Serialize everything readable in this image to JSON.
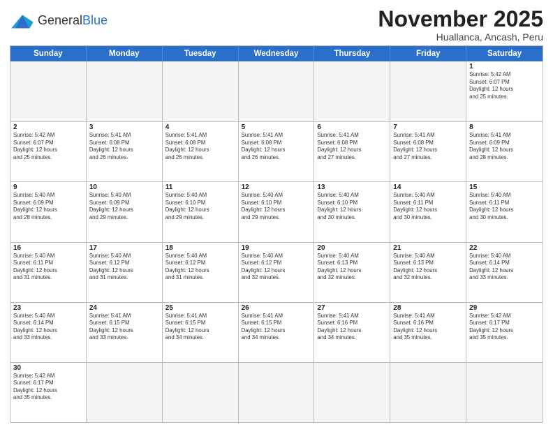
{
  "header": {
    "logo_general": "General",
    "logo_blue": "Blue",
    "title": "November 2025",
    "subtitle": "Huallanca, Ancash, Peru"
  },
  "weekdays": [
    "Sunday",
    "Monday",
    "Tuesday",
    "Wednesday",
    "Thursday",
    "Friday",
    "Saturday"
  ],
  "weeks": [
    [
      {
        "day": "",
        "info": "",
        "empty": true
      },
      {
        "day": "",
        "info": "",
        "empty": true
      },
      {
        "day": "",
        "info": "",
        "empty": true
      },
      {
        "day": "",
        "info": "",
        "empty": true
      },
      {
        "day": "",
        "info": "",
        "empty": true
      },
      {
        "day": "",
        "info": "",
        "empty": true
      },
      {
        "day": "1",
        "info": "Sunrise: 5:42 AM\nSunset: 6:07 PM\nDaylight: 12 hours\nand 25 minutes."
      }
    ],
    [
      {
        "day": "2",
        "info": "Sunrise: 5:42 AM\nSunset: 6:07 PM\nDaylight: 12 hours\nand 25 minutes."
      },
      {
        "day": "3",
        "info": "Sunrise: 5:41 AM\nSunset: 6:08 PM\nDaylight: 12 hours\nand 26 minutes."
      },
      {
        "day": "4",
        "info": "Sunrise: 5:41 AM\nSunset: 6:08 PM\nDaylight: 12 hours\nand 26 minutes."
      },
      {
        "day": "5",
        "info": "Sunrise: 5:41 AM\nSunset: 6:08 PM\nDaylight: 12 hours\nand 26 minutes."
      },
      {
        "day": "6",
        "info": "Sunrise: 5:41 AM\nSunset: 6:08 PM\nDaylight: 12 hours\nand 27 minutes."
      },
      {
        "day": "7",
        "info": "Sunrise: 5:41 AM\nSunset: 6:08 PM\nDaylight: 12 hours\nand 27 minutes."
      },
      {
        "day": "8",
        "info": "Sunrise: 5:41 AM\nSunset: 6:09 PM\nDaylight: 12 hours\nand 28 minutes."
      }
    ],
    [
      {
        "day": "9",
        "info": "Sunrise: 5:40 AM\nSunset: 6:09 PM\nDaylight: 12 hours\nand 28 minutes."
      },
      {
        "day": "10",
        "info": "Sunrise: 5:40 AM\nSunset: 6:09 PM\nDaylight: 12 hours\nand 29 minutes."
      },
      {
        "day": "11",
        "info": "Sunrise: 5:40 AM\nSunset: 6:10 PM\nDaylight: 12 hours\nand 29 minutes."
      },
      {
        "day": "12",
        "info": "Sunrise: 5:40 AM\nSunset: 6:10 PM\nDaylight: 12 hours\nand 29 minutes."
      },
      {
        "day": "13",
        "info": "Sunrise: 5:40 AM\nSunset: 6:10 PM\nDaylight: 12 hours\nand 30 minutes."
      },
      {
        "day": "14",
        "info": "Sunrise: 5:40 AM\nSunset: 6:11 PM\nDaylight: 12 hours\nand 30 minutes."
      },
      {
        "day": "15",
        "info": "Sunrise: 5:40 AM\nSunset: 6:11 PM\nDaylight: 12 hours\nand 30 minutes."
      }
    ],
    [
      {
        "day": "16",
        "info": "Sunrise: 5:40 AM\nSunset: 6:11 PM\nDaylight: 12 hours\nand 31 minutes."
      },
      {
        "day": "17",
        "info": "Sunrise: 5:40 AM\nSunset: 6:12 PM\nDaylight: 12 hours\nand 31 minutes."
      },
      {
        "day": "18",
        "info": "Sunrise: 5:40 AM\nSunset: 6:12 PM\nDaylight: 12 hours\nand 31 minutes."
      },
      {
        "day": "19",
        "info": "Sunrise: 5:40 AM\nSunset: 6:12 PM\nDaylight: 12 hours\nand 32 minutes."
      },
      {
        "day": "20",
        "info": "Sunrise: 5:40 AM\nSunset: 6:13 PM\nDaylight: 12 hours\nand 32 minutes."
      },
      {
        "day": "21",
        "info": "Sunrise: 5:40 AM\nSunset: 6:13 PM\nDaylight: 12 hours\nand 32 minutes."
      },
      {
        "day": "22",
        "info": "Sunrise: 5:40 AM\nSunset: 6:14 PM\nDaylight: 12 hours\nand 33 minutes."
      }
    ],
    [
      {
        "day": "23",
        "info": "Sunrise: 5:40 AM\nSunset: 6:14 PM\nDaylight: 12 hours\nand 33 minutes."
      },
      {
        "day": "24",
        "info": "Sunrise: 5:41 AM\nSunset: 6:15 PM\nDaylight: 12 hours\nand 33 minutes."
      },
      {
        "day": "25",
        "info": "Sunrise: 5:41 AM\nSunset: 6:15 PM\nDaylight: 12 hours\nand 34 minutes."
      },
      {
        "day": "26",
        "info": "Sunrise: 5:41 AM\nSunset: 6:15 PM\nDaylight: 12 hours\nand 34 minutes."
      },
      {
        "day": "27",
        "info": "Sunrise: 5:41 AM\nSunset: 6:16 PM\nDaylight: 12 hours\nand 34 minutes."
      },
      {
        "day": "28",
        "info": "Sunrise: 5:41 AM\nSunset: 6:16 PM\nDaylight: 12 hours\nand 35 minutes."
      },
      {
        "day": "29",
        "info": "Sunrise: 5:42 AM\nSunset: 6:17 PM\nDaylight: 12 hours\nand 35 minutes."
      }
    ],
    [
      {
        "day": "30",
        "info": "Sunrise: 5:42 AM\nSunset: 6:17 PM\nDaylight: 12 hours\nand 35 minutes."
      },
      {
        "day": "",
        "info": "",
        "empty": true
      },
      {
        "day": "",
        "info": "",
        "empty": true
      },
      {
        "day": "",
        "info": "",
        "empty": true
      },
      {
        "day": "",
        "info": "",
        "empty": true
      },
      {
        "day": "",
        "info": "",
        "empty": true
      },
      {
        "day": "",
        "info": "",
        "empty": true
      }
    ]
  ]
}
